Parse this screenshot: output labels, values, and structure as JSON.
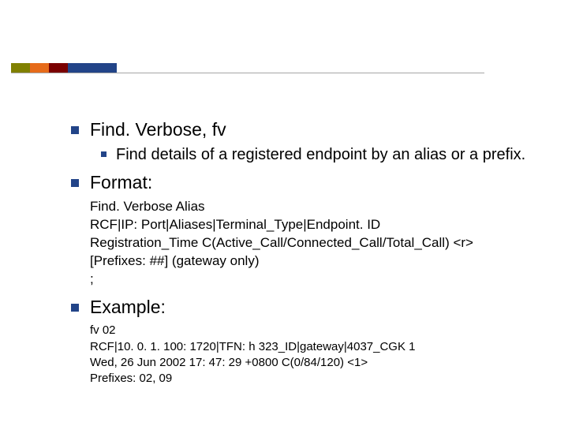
{
  "items": [
    {
      "text": "Find. Verbose, fv",
      "sub": [
        "Find details of a registered endpoint by an alias or a prefix."
      ]
    },
    {
      "text": "Format:",
      "lines": [
        "Find. Verbose Alias",
        "RCF|IP: Port|Aliases|Terminal_Type|Endpoint. ID",
        "Registration_Time C(Active_Call/Connected_Call/Total_Call) <r>",
        "[Prefixes: ##] (gateway only)",
        ";"
      ]
    },
    {
      "text": "Example:",
      "lines": [
        "fv 02",
        "RCF|10. 0. 1. 100: 1720|TFN: h 323_ID|gateway|4037_CGK 1",
        "Wed, 26 Jun 2002 17: 47: 29 +0800 C(0/84/120) <1>",
        "Prefixes: 02, 09"
      ]
    }
  ]
}
